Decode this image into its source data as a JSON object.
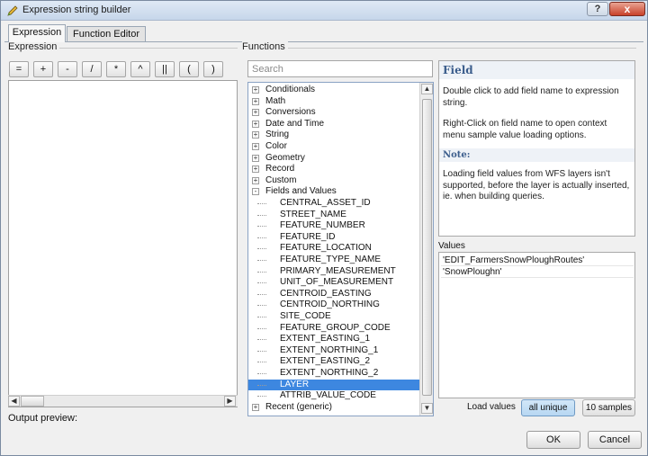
{
  "window": {
    "title": "Expression string builder"
  },
  "title_buttons": {
    "help": "?",
    "close": "x"
  },
  "tabs": [
    {
      "label": "Expression"
    },
    {
      "label": "Function Editor"
    }
  ],
  "expression": {
    "group_label": "Expression",
    "operators": [
      "=",
      "+",
      "-",
      "/",
      "*",
      "^",
      "||",
      "(",
      ")"
    ],
    "output_preview_label": "Output preview:"
  },
  "functions": {
    "group_label": "Functions",
    "search_placeholder": "Search",
    "tree": [
      {
        "label": "Conditionals",
        "level": 0,
        "expander": "+"
      },
      {
        "label": "Math",
        "level": 0,
        "expander": "+"
      },
      {
        "label": "Conversions",
        "level": 0,
        "expander": "+"
      },
      {
        "label": "Date and Time",
        "level": 0,
        "expander": "+"
      },
      {
        "label": "String",
        "level": 0,
        "expander": "+"
      },
      {
        "label": "Color",
        "level": 0,
        "expander": "+"
      },
      {
        "label": "Geometry",
        "level": 0,
        "expander": "+"
      },
      {
        "label": "Record",
        "level": 0,
        "expander": "+"
      },
      {
        "label": "Custom",
        "level": 0,
        "expander": "+"
      },
      {
        "label": "Fields and Values",
        "level": 0,
        "expander": "-"
      },
      {
        "label": "CENTRAL_ASSET_ID",
        "level": 1
      },
      {
        "label": "STREET_NAME",
        "level": 1
      },
      {
        "label": "FEATURE_NUMBER",
        "level": 1
      },
      {
        "label": "FEATURE_ID",
        "level": 1
      },
      {
        "label": "FEATURE_LOCATION",
        "level": 1
      },
      {
        "label": "FEATURE_TYPE_NAME",
        "level": 1
      },
      {
        "label": "PRIMARY_MEASUREMENT",
        "level": 1
      },
      {
        "label": "UNIT_OF_MEASUREMENT",
        "level": 1
      },
      {
        "label": "CENTROID_EASTING",
        "level": 1
      },
      {
        "label": "CENTROID_NORTHING",
        "level": 1
      },
      {
        "label": "SITE_CODE",
        "level": 1
      },
      {
        "label": "FEATURE_GROUP_CODE",
        "level": 1
      },
      {
        "label": "EXTENT_EASTING_1",
        "level": 1
      },
      {
        "label": "EXTENT_NORTHING_1",
        "level": 1
      },
      {
        "label": "EXTENT_EASTING_2",
        "level": 1
      },
      {
        "label": "EXTENT_NORTHING_2",
        "level": 1
      },
      {
        "label": "LAYER",
        "level": 1,
        "selected": true
      },
      {
        "label": "ATTRIB_VALUE_CODE",
        "level": 1
      },
      {
        "label": "Recent (generic)",
        "level": 0,
        "expander": "+"
      }
    ]
  },
  "help": {
    "title": "Field",
    "paragraph1": "Double click to add field name to expression string.",
    "paragraph2": "Right-Click on field name to open context menu sample value loading options.",
    "note_title": "Note:",
    "note_text": "Loading field values from WFS layers isn't supported, before the layer is actually inserted, ie. when building queries."
  },
  "values": {
    "label": "Values",
    "items": [
      "'EDIT_FarmersSnowPloughRoutes'",
      "'SnowPloughn'"
    ],
    "load_label": "Load values",
    "all_unique_label": "all unique",
    "samples_label": "10 samples"
  },
  "dialog": {
    "ok_label": "OK",
    "cancel_label": "Cancel"
  },
  "colors": {
    "selection": "#3d87e0",
    "help_heading": "#3b5d8c"
  }
}
